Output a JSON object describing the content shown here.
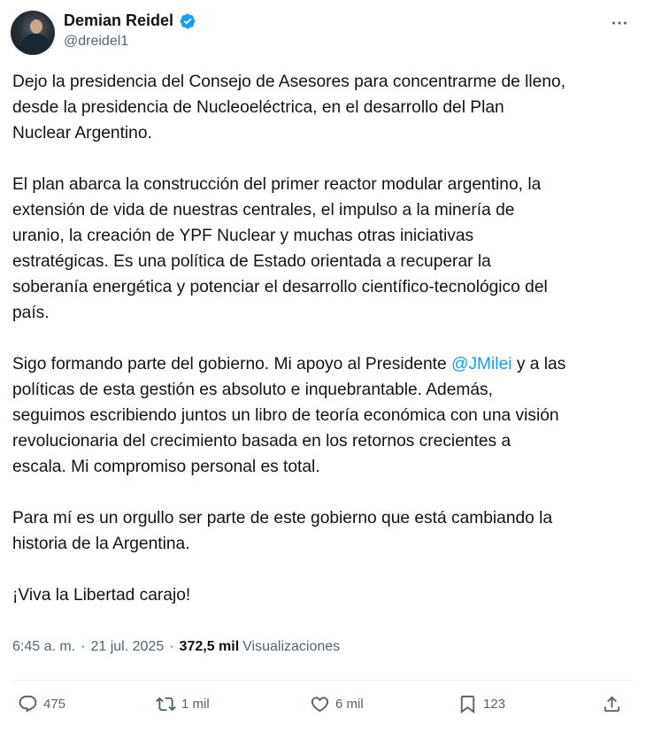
{
  "author": {
    "display_name": "Demian Reidel",
    "handle": "@dreidel1",
    "verified_color": "#1d9bf0"
  },
  "tweet": {
    "paragraphs": [
      {
        "text": "Dejo la presidencia del Consejo de Asesores para concentrarme de lleno,\ndesde la presidencia de Nucleoeléctrica, en el desarrollo del Plan\nNuclear Argentino."
      },
      {
        "text": "El plan abarca la construcción del primer reactor modular argentino, la\nextensión de vida de nuestras centrales, el impulso a la minería de\nuranio, la creación de YPF Nuclear y muchas otras iniciativas\nestratégicas. Es una política de Estado orientada a recuperar la\nsoberanía energética y potenciar el desarrollo científico-tecnológico del\npaís."
      },
      {
        "before": "Sigo formando parte del gobierno. Mi apoyo al Presidente ",
        "mention": "@JMilei",
        "after": " y a las\npolíticas de esta gestión es absoluto e inquebrantable. Además,\nseguimos escribiendo juntos un libro de teoría económica con una visión\nrevolucionaria del crecimiento basada en los retornos crecientes a\nescala. Mi compromiso personal es total."
      },
      {
        "text": "Para mí es un orgullo ser parte de este gobierno que está cambiando la\nhistoria de la Argentina."
      },
      {
        "text": "¡Viva la Libertad carajo!"
      }
    ]
  },
  "meta": {
    "time": "6:45 a. m.",
    "separator": "·",
    "date": "21 jul. 2025",
    "views_count": "372,5 mil",
    "views_label": "Visualizaciones"
  },
  "actions": {
    "replies": "475",
    "reposts": "1 mil",
    "likes": "6 mil",
    "bookmarks": "123"
  },
  "icons": {
    "more": "more-horizontal-icon",
    "reply": "reply-bubble-icon",
    "repost": "repost-arrows-icon",
    "like": "heart-icon",
    "bookmark": "bookmark-icon",
    "share": "share-upload-icon"
  },
  "colors": {
    "text": "#0f1419",
    "secondary": "#536471",
    "link": "#1d9bf0"
  }
}
